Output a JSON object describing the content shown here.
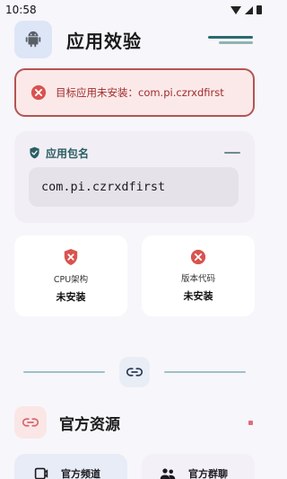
{
  "status_bar": {
    "time": "10:58"
  },
  "header": {
    "title": "应用效验"
  },
  "error_banner": {
    "message": "目标应用未安装：com.pi.czrxdfirst"
  },
  "package": {
    "label": "应用包名",
    "value": "com.pi.czrxdfirst"
  },
  "info_cards": [
    {
      "title": "CPU架构",
      "value": "未安装"
    },
    {
      "title": "版本代码",
      "value": "未安装"
    }
  ],
  "resources": {
    "title": "官方资源"
  },
  "bottom_cards": [
    {
      "label": "官方频道"
    },
    {
      "label": "官方群聊"
    }
  ],
  "colors": {
    "error": "#b45454",
    "accent": "#2a5f62",
    "error_icon": "#d9534f"
  }
}
